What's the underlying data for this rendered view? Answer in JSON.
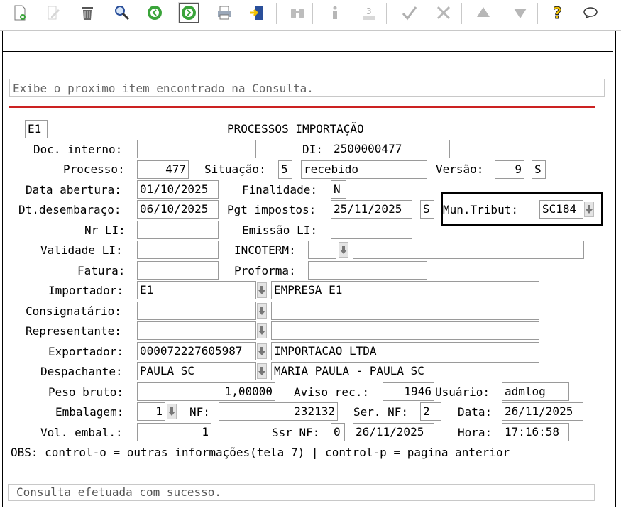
{
  "toolbar": {
    "buttons": [
      "new-doc-icon",
      "edit-icon",
      "trash-icon",
      "search-icon",
      "prev-icon",
      "next-icon",
      "print-icon",
      "exit-icon",
      "binoculars-icon",
      "info-icon",
      "numbers-icon",
      "check-icon",
      "tools-icon",
      "up-icon",
      "down-icon",
      "help-icon",
      "chat-icon"
    ]
  },
  "message_bar": "Exibe o proximo item encontrado na Consulta.",
  "screen_title": "PROCESSOS IMPORTAÇÃO",
  "company_code": "E1",
  "form": {
    "doc_interno_label": "Doc. interno:",
    "doc_interno": "",
    "di_label": "DI:",
    "di": "2500000477",
    "processo_label": "Processo:",
    "processo": "477",
    "situacao_label": "Situação:",
    "situacao_code": "5",
    "situacao_desc": "recebido",
    "versao_label": "Versão:",
    "versao": "9",
    "versao_flag": "S",
    "data_abertura_label": "Data abertura:",
    "data_abertura": "01/10/2025",
    "finalidade_label": "Finalidade:",
    "finalidade": "N",
    "dt_desembaraco_label": "Dt.desembaraço:",
    "dt_desembaraco": "06/10/2025",
    "pgt_impostos_label": "Pgt impostos:",
    "pgt_impostos": "25/11/2025",
    "pgt_flag": "S",
    "mun_tribut_label": "Mun.Tribut:",
    "mun_tribut": "SC184",
    "nr_li_label": "Nr LI:",
    "nr_li": "",
    "emissao_li_label": "Emissão LI:",
    "emissao_li": "",
    "validade_li_label": "Validade LI:",
    "validade_li": "",
    "incoterm_label": "INCOTERM:",
    "incoterm": "",
    "incoterm_desc": "",
    "fatura_label": "Fatura:",
    "fatura": "",
    "proforma_label": "Proforma:",
    "proforma": "",
    "importador_label": "Importador:",
    "importador_code": "E1",
    "importador_name": "EMPRESA E1",
    "consignatario_label": "Consignatário:",
    "consignatario_code": "",
    "consignatario_name": "",
    "representante_label": "Representante:",
    "representante_code": "",
    "representante_name": "",
    "exportador_label": "Exportador:",
    "exportador_code": "000072227605987",
    "exportador_name": "IMPORTACAO LTDA",
    "despachante_label": "Despachante:",
    "despachante_code": "PAULA_SC",
    "despachante_name": "MARIA PAULA - PAULA_SC",
    "peso_bruto_label": "Peso bruto:",
    "peso_bruto": "1,00000",
    "aviso_rec_label": "Aviso rec.:",
    "aviso_rec": "1946",
    "usuario_label": "Usuário:",
    "usuario": "admlog",
    "embalagem_label": "Embalagem:",
    "embalagem": "1",
    "nf_label": "NF:",
    "nf": "232132",
    "ser_nf_label": "Ser. NF:",
    "ser_nf": "2",
    "data_label": "Data:",
    "data": "26/11/2025",
    "vol_embal_label": "Vol. embal.:",
    "vol_embal": "1",
    "ssr_nf_label": "Ssr NF:",
    "ssr_nf": "0",
    "ssr_nf_date": "26/11/2025",
    "hora_label": "Hora:",
    "hora": "17:16:58"
  },
  "obs_text": "OBS: control-o = outras informações(tela 7) | control-p = pagina anterior",
  "status_text": "Consulta efetuada com sucesso.",
  "colors": {
    "accent_line": "#cc2222",
    "nav_green": "#3aa43a",
    "help_yellow": "#f2c200"
  }
}
